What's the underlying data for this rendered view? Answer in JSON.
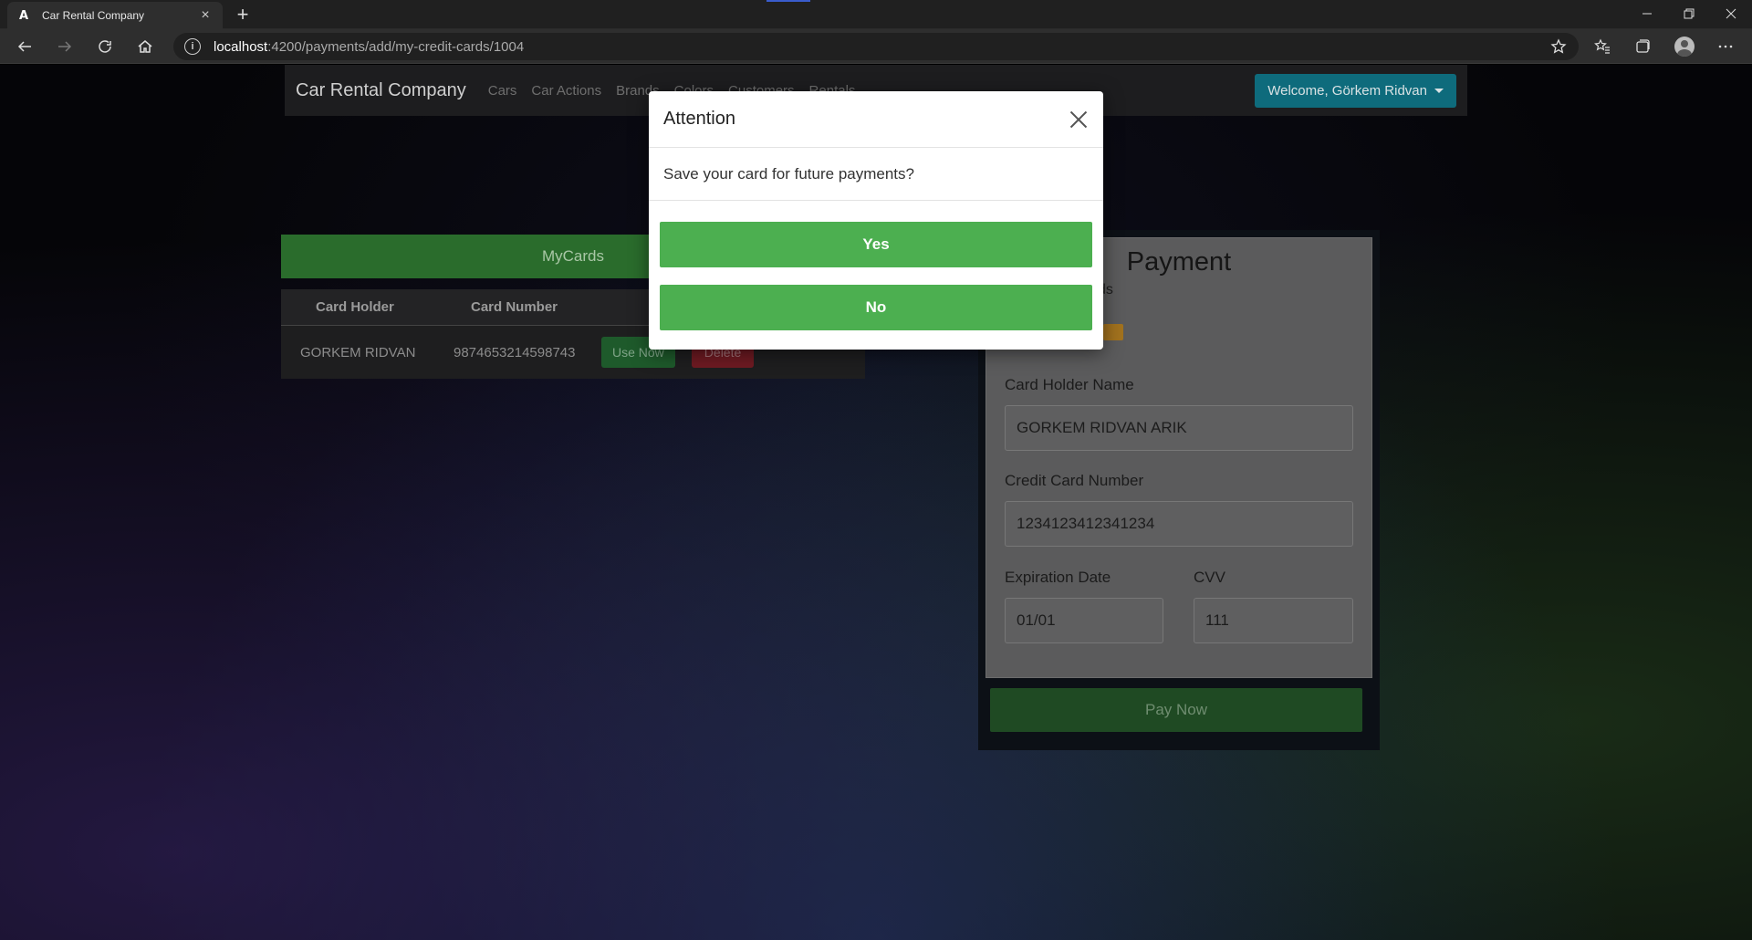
{
  "browser": {
    "tab_title": "Car Rental Company",
    "tab_favicon": "A",
    "tab_close": "×",
    "new_tab": "+",
    "url_host": "localhost",
    "url_rest": ":4200/payments/add/my-credit-cards/1004"
  },
  "navbar": {
    "brand": "Car Rental Company",
    "links": [
      "Cars",
      "Car Actions",
      "Brands",
      "Colors",
      "Customers",
      "Rentals"
    ],
    "welcome": "Welcome, Görkem Ridvan"
  },
  "mycards": {
    "header": "MyCards",
    "columns": [
      "Card Holder",
      "Card Number"
    ],
    "rows": [
      {
        "holder": "GORKEM RIDVAN",
        "number": "9874653214598743",
        "use_label": "Use Now",
        "delete_label": "Delete"
      }
    ]
  },
  "payment": {
    "title": "Payment",
    "subtitle": "ds",
    "holder_label": "Card Holder Name",
    "holder_value": "GORKEM RIDVAN ARIK",
    "number_label": "Credit Card Number",
    "number_value": "1234123412341234",
    "exp_label": "Expiration Date",
    "exp_value": "01/01",
    "cvv_label": "CVV",
    "cvv_value": "111",
    "pay_label": "Pay Now"
  },
  "modal": {
    "title": "Attention",
    "message": "Save your card for future payments?",
    "yes_label": "Yes",
    "no_label": "No"
  },
  "colors": {
    "modal_button": "#4caf50",
    "welcome_button": "#0e6b7c"
  }
}
